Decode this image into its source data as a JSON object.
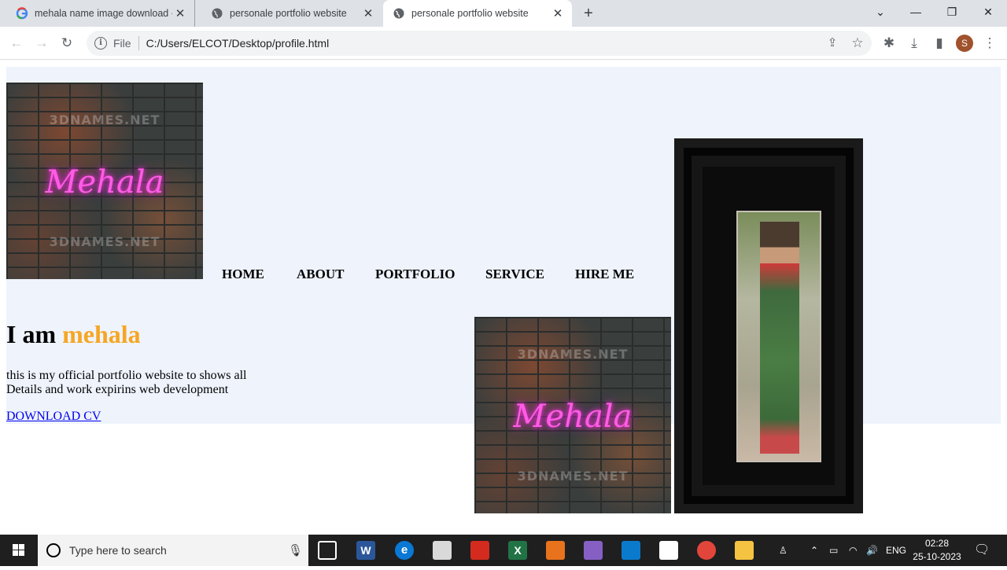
{
  "browser": {
    "tabs": [
      {
        "title": "mehala name image download -",
        "active": false
      },
      {
        "title": "personale portfolio website",
        "active": false
      },
      {
        "title": "personale portfolio website",
        "active": true
      }
    ],
    "address": {
      "scheme_label": "File",
      "url": "C:/Users/ELCOT/Desktop/profile.html"
    },
    "profile_initial": "S"
  },
  "page": {
    "logo": {
      "neon_text": "Mehala",
      "watermark": "3DNAMES.NET"
    },
    "nav": [
      "HOME",
      "ABOUT",
      "PORTFOLIO",
      "SERVICE",
      "HIRE ME"
    ],
    "heading_prefix": "I am",
    "heading_name": "mehala",
    "description_line1": "this is my official portfolio website to shows all",
    "description_line2": "Details and work expirins web development",
    "download_link": "DOWNLOAD CV"
  },
  "taskbar": {
    "search_placeholder": "Type here to search",
    "language": "ENG",
    "time": "02:28",
    "date": "25-10-2023"
  },
  "colors": {
    "hero_bg": "#eef3fc",
    "highlight": "#f6a623",
    "link": "#0000ee"
  }
}
